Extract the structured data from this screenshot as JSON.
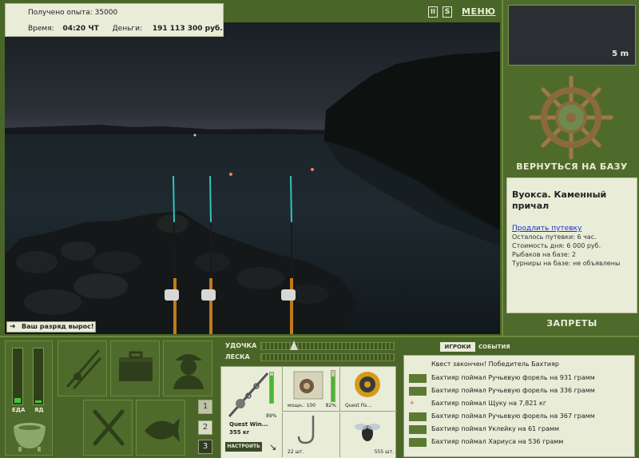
{
  "header": {
    "xp_label": "Получено опыта:",
    "xp_value": "35000",
    "time_label": "Время:",
    "time_value": "04:20 ЧТ",
    "money_label": "Деньги:",
    "money_value": "191 113 300 руб."
  },
  "top_controls": {
    "pause_glyph": "II",
    "settings_glyph": "S",
    "menu_label": "МЕНЮ"
  },
  "right_panel": {
    "depth_label": "5 m",
    "return_label": "ВЕРНУТЬСЯ НА БАЗУ",
    "place_title": "Вуокса. Каменный причал",
    "extend_link": "Продлить путевку",
    "info": [
      "Осталось путевки: 6 час.",
      "Стоимость дня: 6 000 руб.",
      "Рыбаков на базе: 2",
      "Турниры на базе: не объявлены"
    ],
    "bans_label": "ЗАПРЕТЫ"
  },
  "rank_message": "Ваш разряд вырос!",
  "status": {
    "food_label": "ЕДА",
    "poison_label": "ЯД",
    "food_level": 0.08,
    "poison_level": 0.05
  },
  "slots": {
    "numbers": [
      "1",
      "2",
      "3"
    ]
  },
  "tackle": {
    "rod_label": "УДОЧКА",
    "line_label": "ЛЕСКА",
    "rod_name": "Quest Win...",
    "rod_weight": "355 кг",
    "rod_pct": "89%",
    "tune_label": "НАСТРОИТЬ",
    "reel_power": "мощн.: 100",
    "reel_pct": "82%",
    "line_name": "Quest Fis...",
    "hook_count": "22 шт.",
    "bait_count": "555 шт."
  },
  "feed": {
    "tab_players": "ИГРОКИ",
    "tab_events": "СОБЫТИЯ",
    "items": [
      "Квест закончен! Победитель Бахтияр",
      "Бахтияр поймал Ручьевую форель на 931 грамм",
      "Бахтияр поймал Ручьевую форель на 336 грамм",
      "Бахтияр поймал Щуку на 7,821 кг",
      "Бахтияр поймал Ручьевую форель на 367 грамм",
      "Бахтияр поймал Уклейку на 61 грамм",
      "Бахтияр поймал Хариуса на 536 грамм"
    ]
  },
  "colors": {
    "panel_green": "#4a6528",
    "cream": "#e9ecd7",
    "link_blue": "#1836c8",
    "bar_green": "#45c63a"
  }
}
